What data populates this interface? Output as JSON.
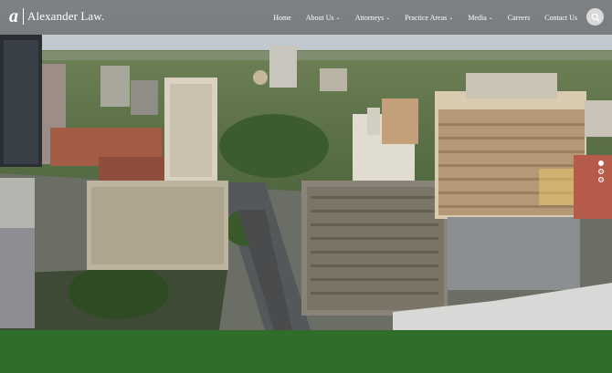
{
  "brand": {
    "mark": "a",
    "name": "Alexander Law."
  },
  "nav": {
    "items": [
      {
        "label": "Home",
        "has_menu": false
      },
      {
        "label": "About Us",
        "has_menu": true
      },
      {
        "label": "Attorneys",
        "has_menu": true
      },
      {
        "label": "Practice Areas",
        "has_menu": true
      },
      {
        "label": "Media",
        "has_menu": true
      },
      {
        "label": "Careers",
        "has_menu": false
      },
      {
        "label": "Contact Us",
        "has_menu": false
      }
    ],
    "search_icon": "search-icon"
  },
  "hero": {
    "image": "aerial-city-skyline",
    "slides": 3,
    "active_slide": 1
  },
  "colors": {
    "footer_green": "#2f6d2b",
    "nav_overlay": "#3c3c3c",
    "search_bg": "#d9d9d9"
  }
}
